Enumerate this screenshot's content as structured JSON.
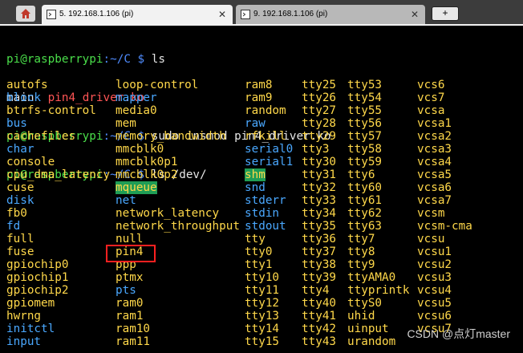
{
  "tabs": [
    {
      "label": "5. 192.168.1.106 (pi)",
      "active": true
    },
    {
      "label": "9. 192.168.1.106 (pi)",
      "active": false
    }
  ],
  "tab_close": "✕",
  "new_tab": "+",
  "terminal": {
    "lines": [
      {
        "prompt_user": "pi@raspberrypi",
        "prompt_path": ":~/C $ ",
        "cmd": "ls"
      },
      {
        "out_a": "main  ",
        "out_b": "pin4_driver.ko"
      },
      {
        "prompt_user": "pi@raspberrypi",
        "prompt_path": ":~/C $ ",
        "cmd": "sudo insmod pin4_driver.ko"
      },
      {
        "prompt_user": "pi@raspberrypi",
        "prompt_path": ":~/C $ ",
        "cmd": "ls /dev/"
      }
    ]
  },
  "dev_columns": [
    [
      {
        "t": "autofs",
        "k": "y"
      },
      {
        "t": "block",
        "k": "c"
      },
      {
        "t": "btrfs-control",
        "k": "y"
      },
      {
        "t": "bus",
        "k": "c"
      },
      {
        "t": "cachefiles",
        "k": "y"
      },
      {
        "t": "char",
        "k": "c"
      },
      {
        "t": "console",
        "k": "y"
      },
      {
        "t": "cpu_dma_latency",
        "k": "y"
      },
      {
        "t": "cuse",
        "k": "y"
      },
      {
        "t": "disk",
        "k": "c"
      },
      {
        "t": "fb0",
        "k": "y"
      },
      {
        "t": "fd",
        "k": "c"
      },
      {
        "t": "full",
        "k": "y"
      },
      {
        "t": "fuse",
        "k": "y"
      },
      {
        "t": "gpiochip0",
        "k": "y"
      },
      {
        "t": "gpiochip1",
        "k": "y"
      },
      {
        "t": "gpiochip2",
        "k": "y"
      },
      {
        "t": "gpiomem",
        "k": "y"
      },
      {
        "t": "hwrng",
        "k": "y"
      },
      {
        "t": "initctl",
        "k": "c"
      },
      {
        "t": "input",
        "k": "c"
      }
    ],
    [
      {
        "t": "loop-control",
        "k": "y"
      },
      {
        "t": "mapper",
        "k": "c"
      },
      {
        "t": "media0",
        "k": "y"
      },
      {
        "t": "mem",
        "k": "y"
      },
      {
        "t": "memory_bandwidth",
        "k": "y"
      },
      {
        "t": "mmcblk0",
        "k": "y"
      },
      {
        "t": "mmcblk0p1",
        "k": "y"
      },
      {
        "t": "mmcblk0p2",
        "k": "y"
      },
      {
        "t": "mqueue",
        "k": "hl"
      },
      {
        "t": "net",
        "k": "c"
      },
      {
        "t": "network_latency",
        "k": "y"
      },
      {
        "t": "network_throughput",
        "k": "y"
      },
      {
        "t": "null",
        "k": "y"
      },
      {
        "t": "pin4",
        "k": "y"
      },
      {
        "t": "ppp",
        "k": "y"
      },
      {
        "t": "ptmx",
        "k": "y"
      },
      {
        "t": "pts",
        "k": "c"
      },
      {
        "t": "ram0",
        "k": "y"
      },
      {
        "t": "ram1",
        "k": "y"
      },
      {
        "t": "ram10",
        "k": "y"
      },
      {
        "t": "ram11",
        "k": "y"
      }
    ],
    [
      {
        "t": "ram8",
        "k": "y"
      },
      {
        "t": "ram9",
        "k": "y"
      },
      {
        "t": "random",
        "k": "y"
      },
      {
        "t": "raw",
        "k": "c"
      },
      {
        "t": "rfkill",
        "k": "y"
      },
      {
        "t": "serial0",
        "k": "c"
      },
      {
        "t": "serial1",
        "k": "c"
      },
      {
        "t": "shm",
        "k": "hl"
      },
      {
        "t": "snd",
        "k": "c"
      },
      {
        "t": "stderr",
        "k": "c"
      },
      {
        "t": "stdin",
        "k": "c"
      },
      {
        "t": "stdout",
        "k": "c"
      },
      {
        "t": "tty",
        "k": "y"
      },
      {
        "t": "tty0",
        "k": "y"
      },
      {
        "t": "tty1",
        "k": "y"
      },
      {
        "t": "tty10",
        "k": "y"
      },
      {
        "t": "tty11",
        "k": "y"
      },
      {
        "t": "tty12",
        "k": "y"
      },
      {
        "t": "tty13",
        "k": "y"
      },
      {
        "t": "tty14",
        "k": "y"
      },
      {
        "t": "tty15",
        "k": "y"
      }
    ],
    [
      {
        "t": "tty25",
        "k": "y"
      },
      {
        "t": "tty26",
        "k": "y"
      },
      {
        "t": "tty27",
        "k": "y"
      },
      {
        "t": "tty28",
        "k": "y"
      },
      {
        "t": "tty29",
        "k": "y"
      },
      {
        "t": "tty3",
        "k": "y"
      },
      {
        "t": "tty30",
        "k": "y"
      },
      {
        "t": "tty31",
        "k": "y"
      },
      {
        "t": "tty32",
        "k": "y"
      },
      {
        "t": "tty33",
        "k": "y"
      },
      {
        "t": "tty34",
        "k": "y"
      },
      {
        "t": "tty35",
        "k": "y"
      },
      {
        "t": "tty36",
        "k": "y"
      },
      {
        "t": "tty37",
        "k": "y"
      },
      {
        "t": "tty38",
        "k": "y"
      },
      {
        "t": "tty39",
        "k": "y"
      },
      {
        "t": "tty4",
        "k": "y"
      },
      {
        "t": "tty40",
        "k": "y"
      },
      {
        "t": "tty41",
        "k": "y"
      },
      {
        "t": "tty42",
        "k": "y"
      },
      {
        "t": "tty43",
        "k": "y"
      }
    ],
    [
      {
        "t": "tty53",
        "k": "y"
      },
      {
        "t": "tty54",
        "k": "y"
      },
      {
        "t": "tty55",
        "k": "y"
      },
      {
        "t": "tty56",
        "k": "y"
      },
      {
        "t": "tty57",
        "k": "y"
      },
      {
        "t": "tty58",
        "k": "y"
      },
      {
        "t": "tty59",
        "k": "y"
      },
      {
        "t": "tty6",
        "k": "y"
      },
      {
        "t": "tty60",
        "k": "y"
      },
      {
        "t": "tty61",
        "k": "y"
      },
      {
        "t": "tty62",
        "k": "y"
      },
      {
        "t": "tty63",
        "k": "y"
      },
      {
        "t": "tty7",
        "k": "y"
      },
      {
        "t": "tty8",
        "k": "y"
      },
      {
        "t": "tty9",
        "k": "y"
      },
      {
        "t": "ttyAMA0",
        "k": "y"
      },
      {
        "t": "ttyprintk",
        "k": "y"
      },
      {
        "t": "ttyS0",
        "k": "y"
      },
      {
        "t": "uhid",
        "k": "y"
      },
      {
        "t": "uinput",
        "k": "y"
      },
      {
        "t": "urandom",
        "k": "y"
      }
    ],
    [
      {
        "t": "vcs6",
        "k": "y"
      },
      {
        "t": "vcs7",
        "k": "y"
      },
      {
        "t": "vcsa",
        "k": "y"
      },
      {
        "t": "vcsa1",
        "k": "y"
      },
      {
        "t": "vcsa2",
        "k": "y"
      },
      {
        "t": "vcsa3",
        "k": "y"
      },
      {
        "t": "vcsa4",
        "k": "y"
      },
      {
        "t": "vcsa5",
        "k": "y"
      },
      {
        "t": "vcsa6",
        "k": "y"
      },
      {
        "t": "vcsa7",
        "k": "y"
      },
      {
        "t": "vcsm",
        "k": "y"
      },
      {
        "t": "vcsm-cma",
        "k": "y"
      },
      {
        "t": "vcsu",
        "k": "y"
      },
      {
        "t": "vcsu1",
        "k": "y"
      },
      {
        "t": "vcsu2",
        "k": "y"
      },
      {
        "t": "vcsu3",
        "k": "y"
      },
      {
        "t": "vcsu4",
        "k": "y"
      },
      {
        "t": "vcsu5",
        "k": "y"
      },
      {
        "t": "vcsu6",
        "k": "y"
      },
      {
        "t": "vcsu7",
        "k": "y"
      },
      {
        "t": "",
        "k": "y"
      }
    ]
  ],
  "watermark": "CSDN @点灯master",
  "colors": {
    "prompt": "#4ade4a",
    "path": "#4f8cff",
    "file_exec": "#ffd84a",
    "dir": "#4aa8ff",
    "highlight": "#1f9d55",
    "ko_file": "#ff5555",
    "annotation": "#ff2020"
  },
  "icons": {
    "home": "home-icon",
    "tab": "terminal-tab-icon"
  }
}
